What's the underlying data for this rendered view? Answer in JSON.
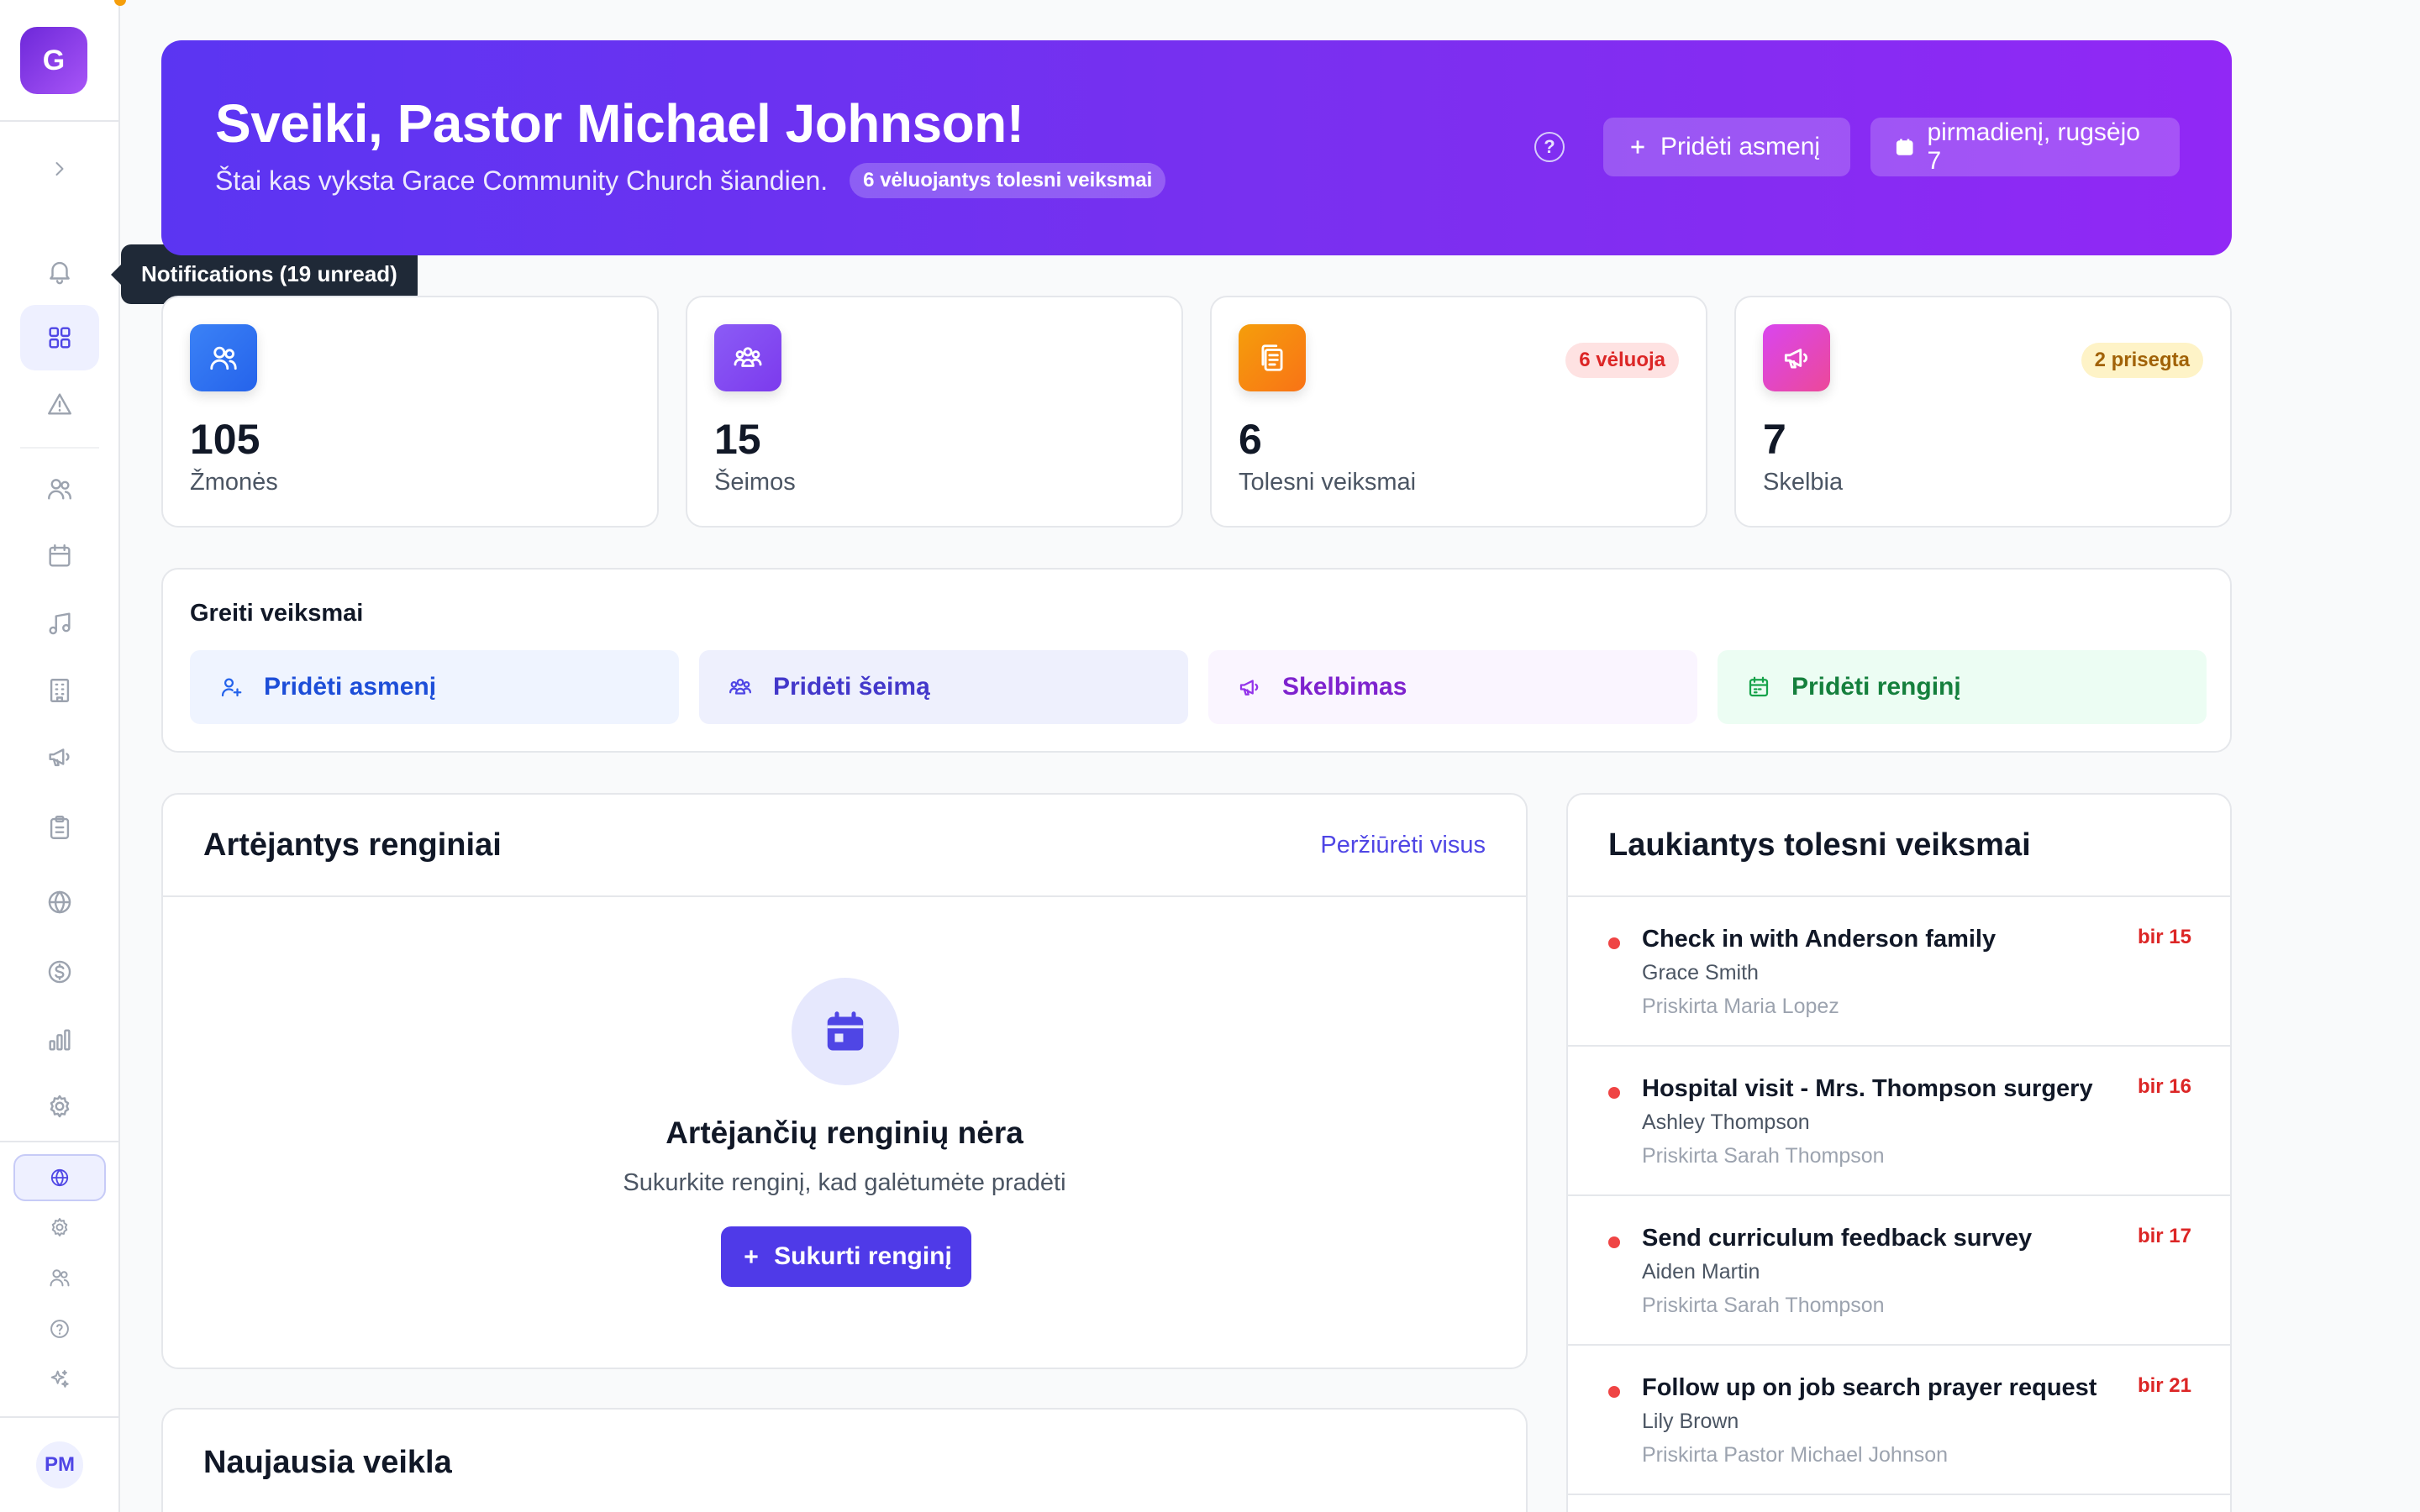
{
  "sidebar": {
    "logo_letter": "G",
    "avatar_initials": "PM",
    "tooltip": "Notifications (19 unread)",
    "items": [
      {
        "name": "expand-chevron-icon"
      },
      {
        "name": "bell-icon"
      },
      {
        "name": "dashboard-grid-icon",
        "active": true
      },
      {
        "name": "alert-triangle-icon"
      },
      {
        "name": "users-icon"
      },
      {
        "name": "calendar-icon"
      },
      {
        "name": "music-icon"
      },
      {
        "name": "building-icon"
      },
      {
        "name": "megaphone-icon"
      },
      {
        "name": "clipboard-icon"
      },
      {
        "name": "globe-icon"
      },
      {
        "name": "dollar-icon"
      },
      {
        "name": "bar-chart-icon"
      },
      {
        "name": "settings-icon"
      }
    ],
    "bottom_items": [
      {
        "name": "language-globe-icon",
        "active": true
      },
      {
        "name": "settings-small-icon"
      },
      {
        "name": "users-small-icon"
      },
      {
        "name": "help-icon"
      },
      {
        "name": "sparkles-icon"
      }
    ]
  },
  "hero": {
    "title": "Sveiki, Pastor Michael Johnson!",
    "subtitle": "Štai kas vyksta Grace Community Church šiandien.",
    "overdue_pill": "6 vėluojantys tolesni veiksmai",
    "help_symbol": "?",
    "add_person_label": "Pridėti asmenį",
    "date_label": "pirmadienį, rugsėjo 7"
  },
  "stats": [
    {
      "value": "105",
      "label": "Žmonės",
      "icon": "users-icon",
      "badge": ""
    },
    {
      "value": "15",
      "label": "Šeimos",
      "icon": "family-icon",
      "badge": ""
    },
    {
      "value": "6",
      "label": "Tolesni veiksmai",
      "icon": "clipboard-icon",
      "badge": "6 vėluoja"
    },
    {
      "value": "7",
      "label": "Skelbia",
      "icon": "megaphone-icon",
      "badge": "2 prisegta"
    }
  ],
  "quick_actions": {
    "title": "Greiti veiksmai",
    "items": [
      {
        "label": "Pridėti asmenį",
        "icon": "user-plus-icon"
      },
      {
        "label": "Pridėti šeimą",
        "icon": "family-icon"
      },
      {
        "label": "Skelbimas",
        "icon": "megaphone-icon"
      },
      {
        "label": "Pridėti renginį",
        "icon": "calendar-icon"
      }
    ]
  },
  "events": {
    "title": "Artėjantys renginiai",
    "view_all": "Peržiūrėti visus",
    "empty_title": "Artėjančių renginių nėra",
    "empty_subtitle": "Sukurkite renginį, kad galėtumėte pradėti",
    "create_label": "Sukurti renginį"
  },
  "activity": {
    "title": "Naujausia veikla"
  },
  "followups": {
    "title": "Laukiantys tolesni veiksmai",
    "items": [
      {
        "title": "Check in with Anderson family",
        "person": "Grace Smith",
        "assigned": "Priskirta Maria Lopez",
        "date": "bir 15"
      },
      {
        "title": "Hospital visit - Mrs. Thompson surgery",
        "person": "Ashley Thompson",
        "assigned": "Priskirta Sarah Thompson",
        "date": "bir 16"
      },
      {
        "title": "Send curriculum feedback survey",
        "person": "Aiden Martin",
        "assigned": "Priskirta Sarah Thompson",
        "date": "bir 17"
      },
      {
        "title": "Follow up on job search prayer request",
        "person": "Lily Brown",
        "assigned": "Priskirta Pastor Michael Johnson",
        "date": "bir 21"
      }
    ]
  },
  "colors": {
    "primary": "#4f46e5",
    "hero_start": "#5b35f2",
    "hero_end": "#9128f5",
    "danger": "#dc2626"
  }
}
